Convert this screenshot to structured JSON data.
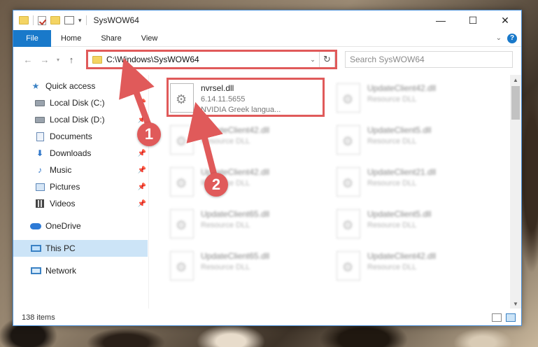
{
  "window": {
    "title": "SysWOW64",
    "controls": {
      "minimize": "—",
      "maximize": "☐",
      "close": "✕"
    }
  },
  "ribbon": {
    "tabs": [
      "File",
      "Home",
      "Share",
      "View"
    ]
  },
  "navbar": {
    "address": "C:\\Windows\\SysWOW64",
    "search_placeholder": "Search SysWOW64"
  },
  "sidebar": {
    "items": [
      {
        "label": "Quick access",
        "icon": "star-icon",
        "pinned": false
      },
      {
        "label": "Local Disk (C:)",
        "icon": "disk-icon",
        "pinned": true
      },
      {
        "label": "Local Disk (D:)",
        "icon": "disk-icon",
        "pinned": true
      },
      {
        "label": "Documents",
        "icon": "documents-icon",
        "pinned": true
      },
      {
        "label": "Downloads",
        "icon": "download-icon",
        "pinned": true
      },
      {
        "label": "Music",
        "icon": "music-icon",
        "pinned": true
      },
      {
        "label": "Pictures",
        "icon": "pictures-icon",
        "pinned": true
      },
      {
        "label": "Videos",
        "icon": "videos-icon",
        "pinned": true
      },
      {
        "label": "OneDrive",
        "icon": "cloud-icon",
        "pinned": false
      },
      {
        "label": "This PC",
        "icon": "pc-icon",
        "pinned": false,
        "selected": true
      },
      {
        "label": "Network",
        "icon": "network-icon",
        "pinned": false
      }
    ]
  },
  "files": {
    "highlighted": {
      "name": "nvrsel.dll",
      "version": "6.14.11.5655",
      "description": "NVIDIA Greek langua..."
    },
    "left_column": [
      {
        "name": "UpdateClient42.dll",
        "type": "Resource DLL"
      },
      {
        "name": "UpdateClient42.dll",
        "type": "Resource DLL"
      },
      {
        "name": "UpdateClient65.dll",
        "type": "Resource DLL"
      },
      {
        "name": "UpdateClient65.dll",
        "type": "Resource DLL"
      }
    ],
    "right_column": [
      {
        "name": "UpdateClient42.dll",
        "type": "Resource DLL"
      },
      {
        "name": "UpdateClient5.dll",
        "type": "Resource DLL"
      },
      {
        "name": "UpdateClient21.dll",
        "type": "Resource DLL"
      },
      {
        "name": "UpdateClient5.dll",
        "type": "Resource DLL"
      },
      {
        "name": "UpdateClient42.dll",
        "type": "Resource DLL"
      }
    ]
  },
  "status": {
    "item_count": "138 items"
  },
  "annotations": {
    "step1": "1",
    "step2": "2"
  },
  "colors": {
    "accent": "#1979ca",
    "highlight": "#e05a5a",
    "selected": "#cce4f7"
  }
}
